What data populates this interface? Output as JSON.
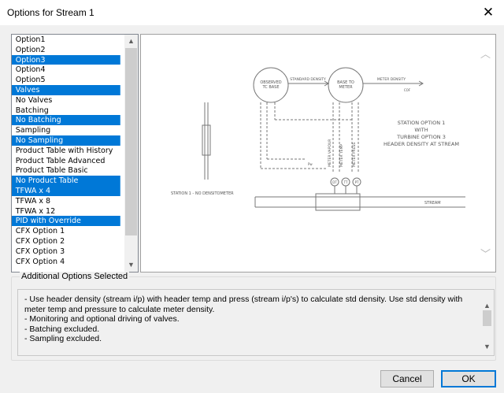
{
  "window": {
    "title": "Options for Stream 1",
    "close_glyph": "✕"
  },
  "options_list": {
    "items": [
      {
        "label": "Option1",
        "selected": false
      },
      {
        "label": "Option2",
        "selected": false
      },
      {
        "label": "Option3",
        "selected": true
      },
      {
        "label": "Option4",
        "selected": false
      },
      {
        "label": "Option5",
        "selected": false
      },
      {
        "label": "Valves",
        "selected": true
      },
      {
        "label": "No Valves",
        "selected": false
      },
      {
        "label": "Batching",
        "selected": false
      },
      {
        "label": "No Batching",
        "selected": true
      },
      {
        "label": "Sampling",
        "selected": false
      },
      {
        "label": "No Sampling",
        "selected": true
      },
      {
        "label": "Product Table with History",
        "selected": false
      },
      {
        "label": "Product Table Advanced",
        "selected": false
      },
      {
        "label": "Product Table Basic",
        "selected": false
      },
      {
        "label": "No Product Table",
        "selected": true
      },
      {
        "label": "TFWA x 4",
        "selected": true
      },
      {
        "label": "TFWA x 8",
        "selected": false
      },
      {
        "label": "TFWA x 12",
        "selected": false
      },
      {
        "label": "PID with Override",
        "selected": true
      },
      {
        "label": "CFX Option 1",
        "selected": false
      },
      {
        "label": "CFX Option 2",
        "selected": false
      },
      {
        "label": "CFX Option 3",
        "selected": false
      },
      {
        "label": "CFX Option 4",
        "selected": false
      }
    ]
  },
  "diagram": {
    "circle1_line1": "OBSERVED",
    "circle1_line2": "TC BASE",
    "circle2_line1": "BASE TO",
    "circle2_line2": "METER",
    "standard_density": "STANDARD DENSITY",
    "meter_density": "METER DENSITY",
    "meter_density_sub": "COF",
    "label_station_option_1": "STATION OPTION 1",
    "label_with": "WITH",
    "label_turbine": "TURBINE OPTION 3",
    "label_header_density": "HEADER DENSITY AT STREAM",
    "meter_vapour": "METER VAPOUR",
    "meter_temp": "METER TEMP",
    "meter_press": "METER PRESS",
    "pw": "Pw",
    "instrument_dt": "DT",
    "instrument_tt": "TT",
    "instrument_pt": "PT",
    "station_label": "STATION 1 - NO DENSITOMETER",
    "stream_label": "STREAM"
  },
  "additional": {
    "group_label": "Additional Options Selected",
    "lines": [
      "- Use header density (stream i/p) with header temp and press (stream i/p's) to calculate std density. Use std density with meter temp and pressure to calculate meter density.",
      "- Monitoring and optional driving of valves.",
      "- Batching excluded.",
      "- Sampling excluded."
    ]
  },
  "buttons": {
    "cancel": "Cancel",
    "ok": "OK"
  }
}
